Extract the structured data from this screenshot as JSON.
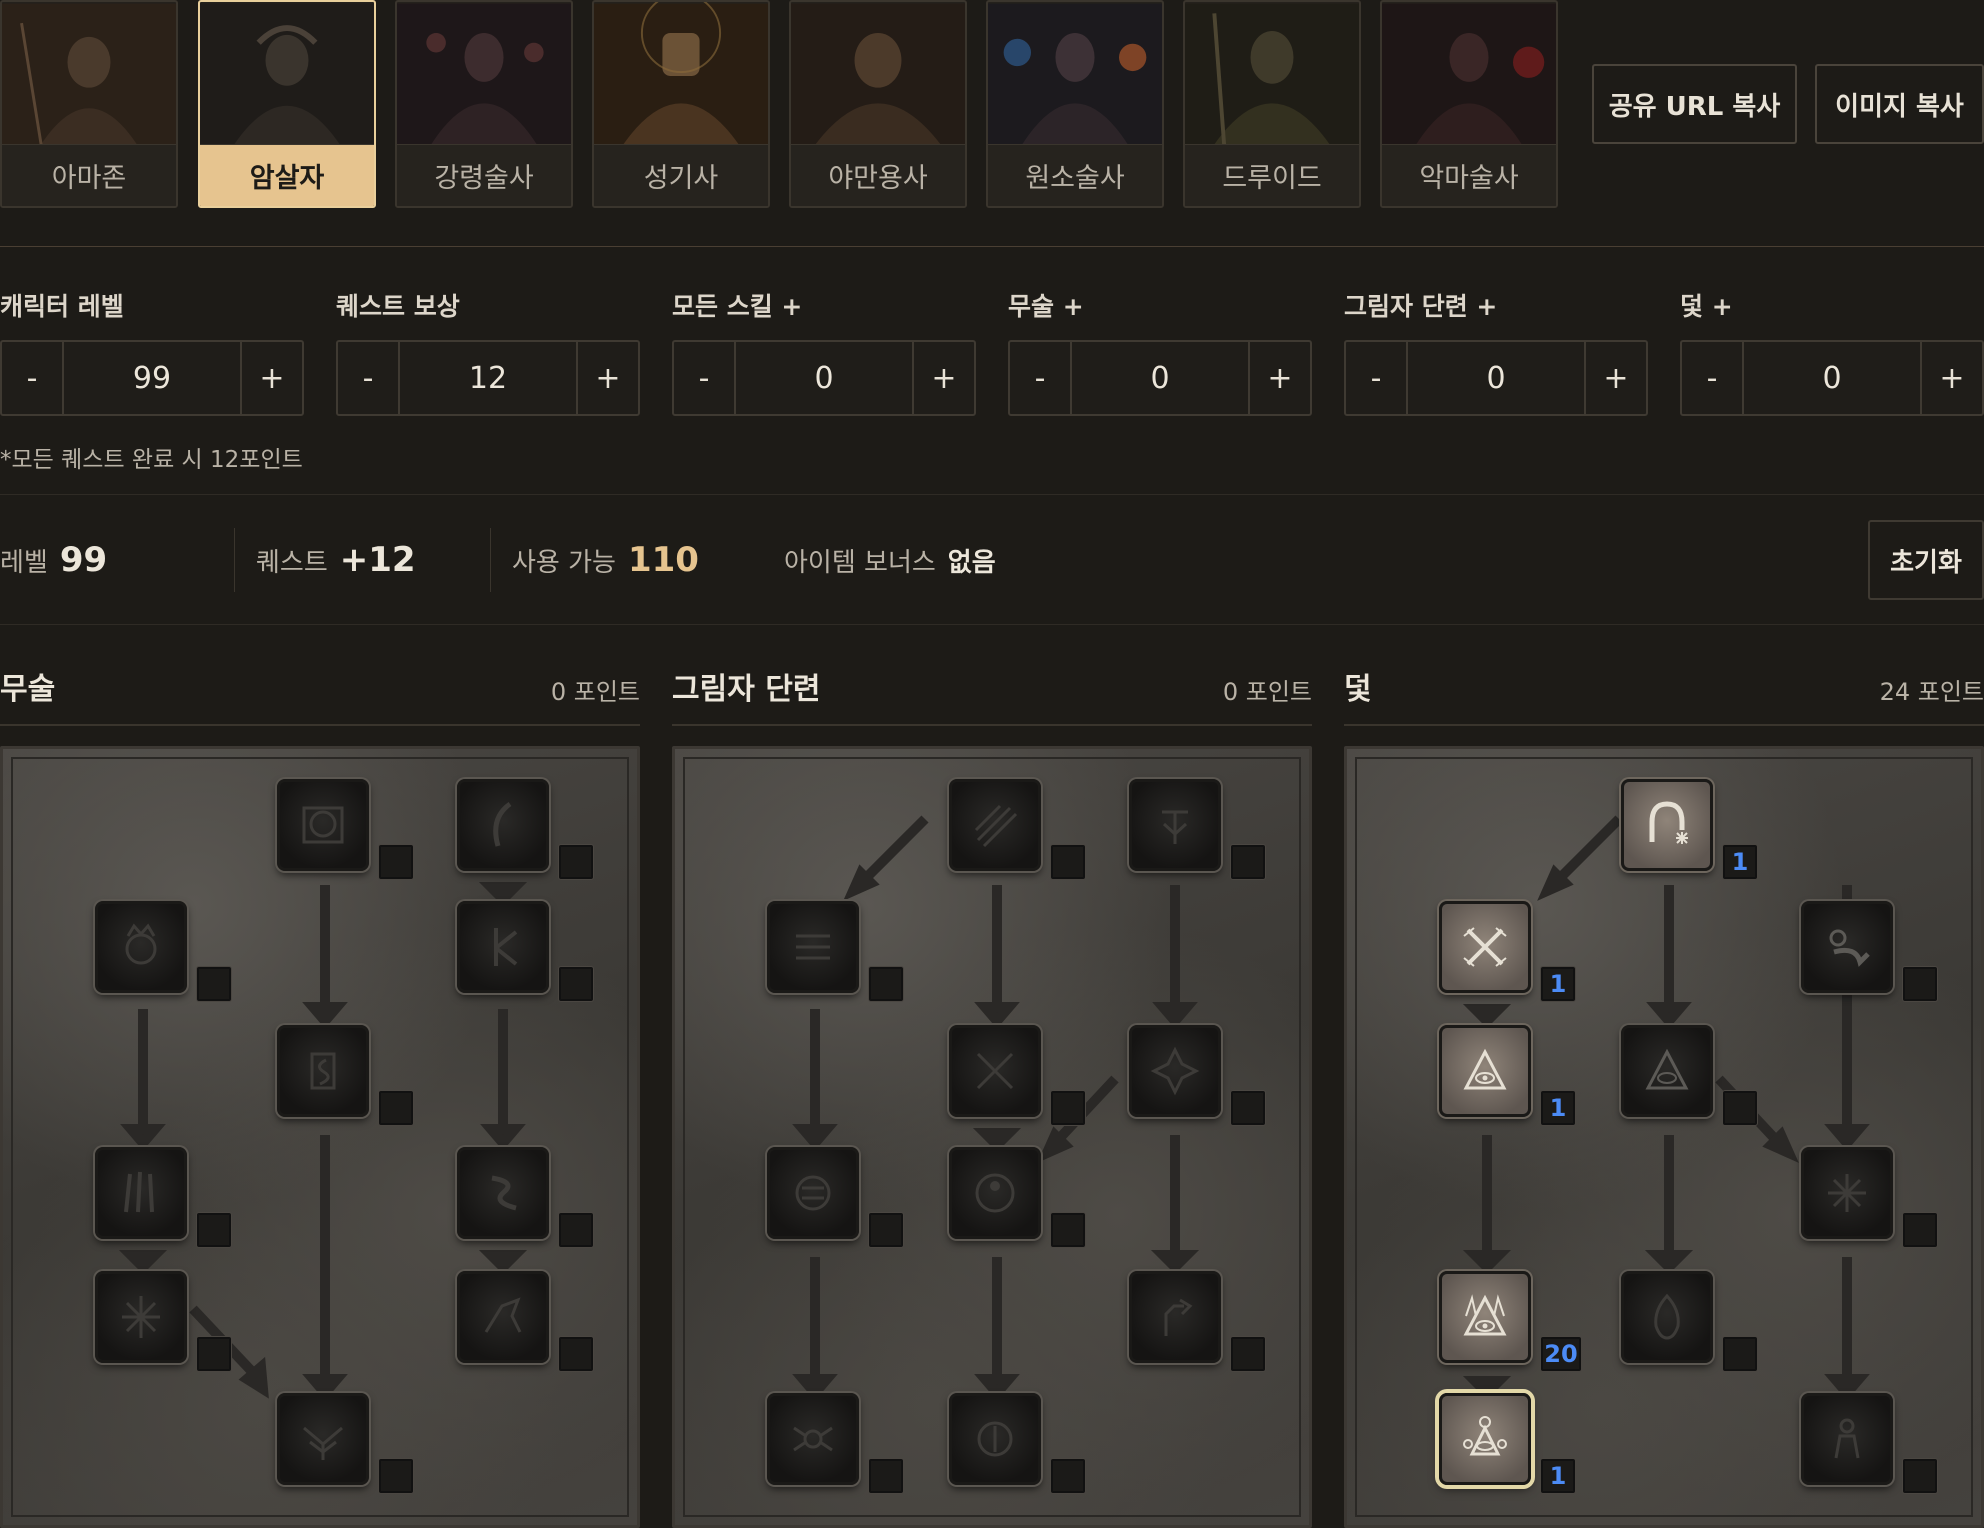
{
  "classes": [
    {
      "label": "아마존",
      "active": false
    },
    {
      "label": "암살자",
      "active": true
    },
    {
      "label": "강령술사",
      "active": false
    },
    {
      "label": "성기사",
      "active": false
    },
    {
      "label": "야만용사",
      "active": false
    },
    {
      "label": "원소술사",
      "active": false
    },
    {
      "label": "드루이드",
      "active": false
    },
    {
      "label": "악마술사",
      "active": false
    }
  ],
  "top_buttons": {
    "share_url": "공유 URL 복사",
    "copy_image": "이미지 복사"
  },
  "steppers": [
    {
      "label": "캐릭터 레벨",
      "value": "99"
    },
    {
      "label": "퀘스트 보상",
      "value": "12"
    },
    {
      "label": "모든 스킬 +",
      "value": "0"
    },
    {
      "label": "무술 +",
      "value": "0"
    },
    {
      "label": "그림자 단련 +",
      "value": "0"
    },
    {
      "label": "덫 +",
      "value": "0"
    }
  ],
  "stepper_minus": "-",
  "stepper_plus": "+",
  "quest_note": "*모든 퀘스트 완료 시 12포인트",
  "summary": {
    "level_label": "레벨",
    "level_value": "99",
    "quest_label": "퀘스트",
    "quest_value": "+12",
    "available_label": "사용 가능",
    "available_value": "110",
    "item_bonus_label": "아이템 보너스",
    "item_bonus_value": "없음",
    "reset": "초기화"
  },
  "trees": [
    {
      "title": "무술",
      "points": "0 포인트"
    },
    {
      "title": "그림자 단련",
      "points": "0 포인트"
    },
    {
      "title": "덫",
      "points": "24 포인트"
    }
  ],
  "trap_levels": {
    "top": "1",
    "row2": "1",
    "row3": "1",
    "row5": "20",
    "row6": "1"
  },
  "colors": {
    "accent_gold": "#e6c48f",
    "level_blue": "#4c8bf5",
    "background": "#1d1b17"
  }
}
